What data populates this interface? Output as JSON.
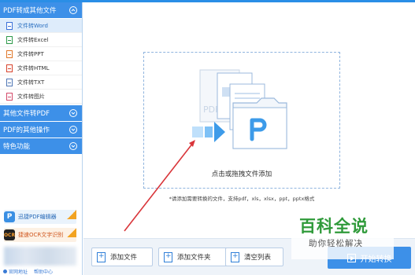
{
  "sidebar": {
    "categories": [
      {
        "label": "PDF转成其他文件",
        "items": [
          {
            "label": "文件转Word",
            "icon": "word-file-icon"
          },
          {
            "label": "文件转Excel",
            "icon": "excel-file-icon"
          },
          {
            "label": "文件转PPT",
            "icon": "ppt-file-icon"
          },
          {
            "label": "文件转HTML",
            "icon": "html-file-icon"
          },
          {
            "label": "文件转TXT",
            "icon": "txt-file-icon"
          },
          {
            "label": "文件转图片",
            "icon": "image-file-icon"
          }
        ]
      },
      {
        "label": "其他文件转PDF"
      },
      {
        "label": "PDF的其他操作"
      },
      {
        "label": "特色功能"
      }
    ],
    "promos": [
      {
        "label": "迅捷PDF编辑器",
        "icon_text": "P"
      },
      {
        "label": "捷速OCR文字识别",
        "icon_text": "OCR"
      }
    ],
    "footer": {
      "link1": "官网地址",
      "link2": "帮助中心"
    }
  },
  "main": {
    "drop_text": "点击或拖拽文件添加",
    "hint": "*请添加需要转换的文件，支持pdf，xls，xlsx，ppt，pptx格式",
    "art_label": "PDF"
  },
  "bottom": {
    "add_file": "添加文件",
    "add_folder": "添加文件夹",
    "clear": "清空列表",
    "start": "开始转换"
  },
  "watermark": {
    "big": "百科全说",
    "small": "助你轻松解决"
  },
  "colors": {
    "accent": "#3d90e8",
    "arrow": "#d9353a",
    "watermark": "#2f9a3a"
  }
}
